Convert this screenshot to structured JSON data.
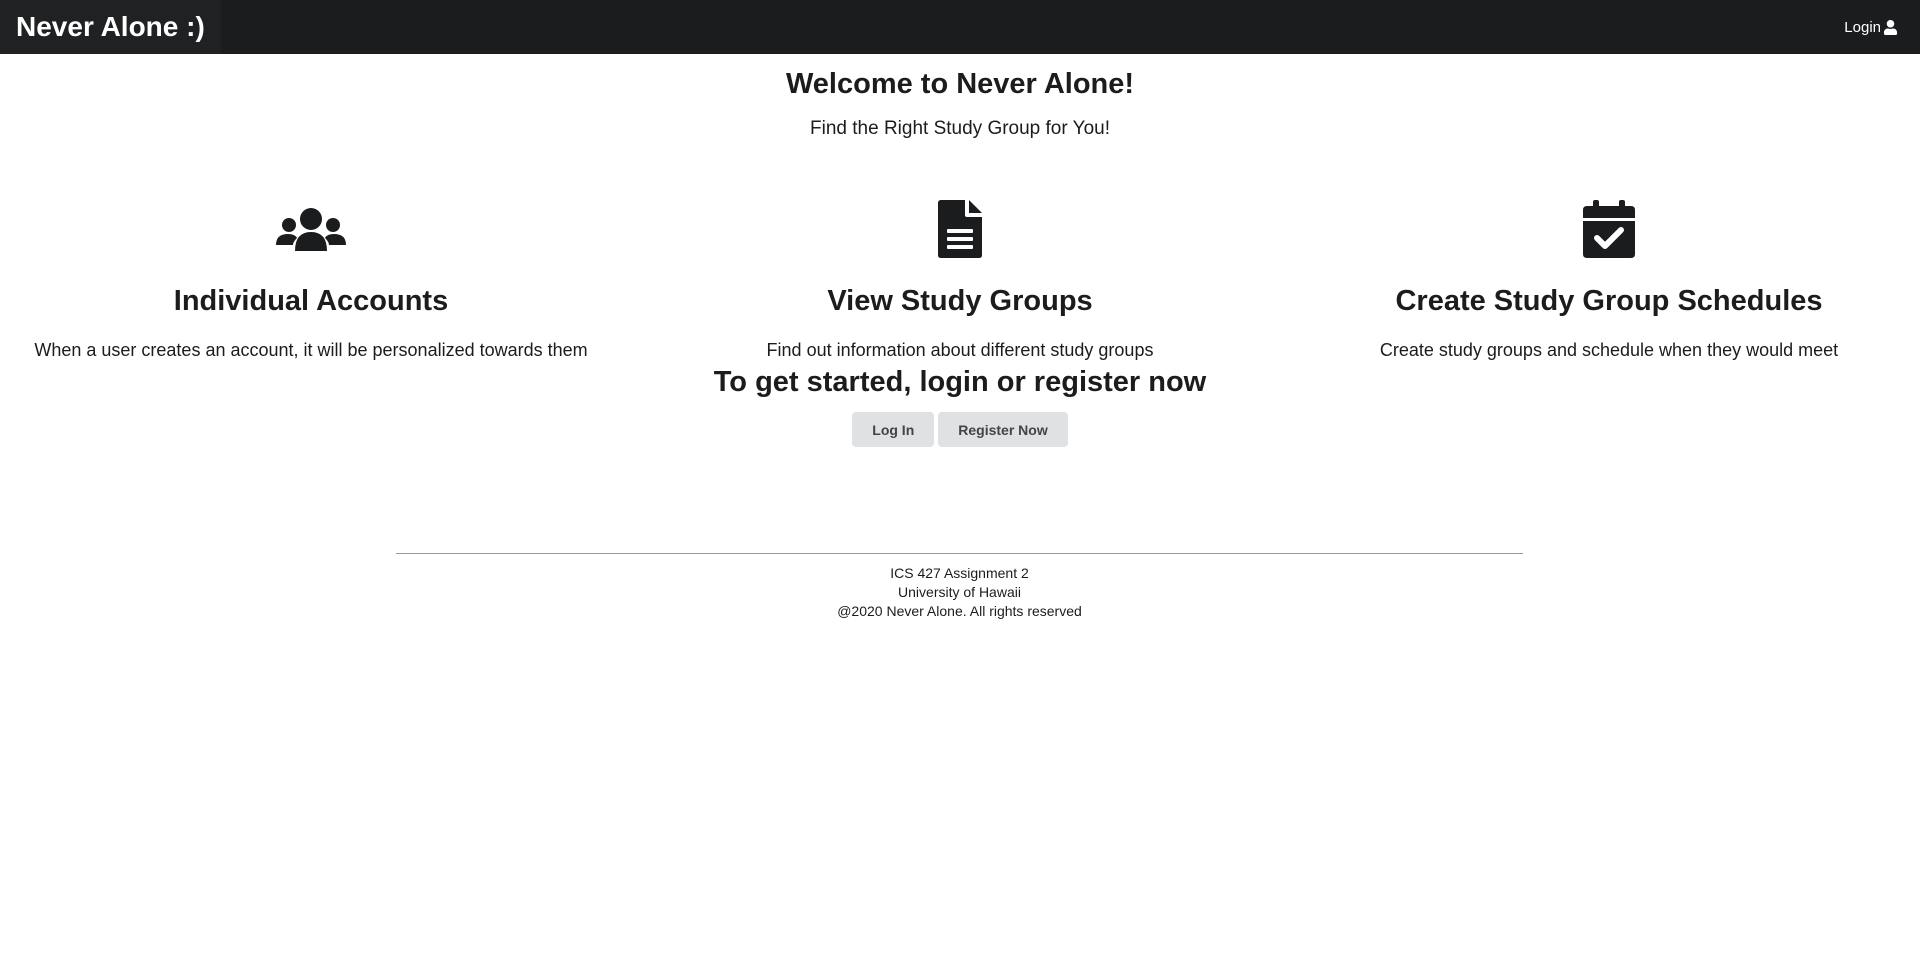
{
  "navbar": {
    "brand": "Never Alone :)",
    "login_label": "Login",
    "login_icon": "user-icon"
  },
  "hero": {
    "title": "Welcome to Never Alone!",
    "subtitle": "Find the Right Study Group for You!"
  },
  "features": [
    {
      "icon": "users-icon",
      "title": "Individual Accounts",
      "description": "When a user creates an account, it will be personalized towards them"
    },
    {
      "icon": "file-alt-icon",
      "title": "View Study Groups",
      "description": "Find out information about different study groups"
    },
    {
      "icon": "calendar-check-icon",
      "title": "Create Study Group Schedules",
      "description": "Create study groups and schedule when they would meet"
    }
  ],
  "cta": {
    "heading": "To get started, login or register now",
    "login_button": "Log In",
    "register_button": "Register Now"
  },
  "footer": {
    "line1": "ICS 427 Assignment 2",
    "line2": "University of Hawaii",
    "line3": "@2020 Never Alone. All rights reserved"
  },
  "colors": {
    "navbar_bg": "#1b1c1d",
    "text": "#1b1c1d",
    "button_bg": "#e0e1e2"
  }
}
